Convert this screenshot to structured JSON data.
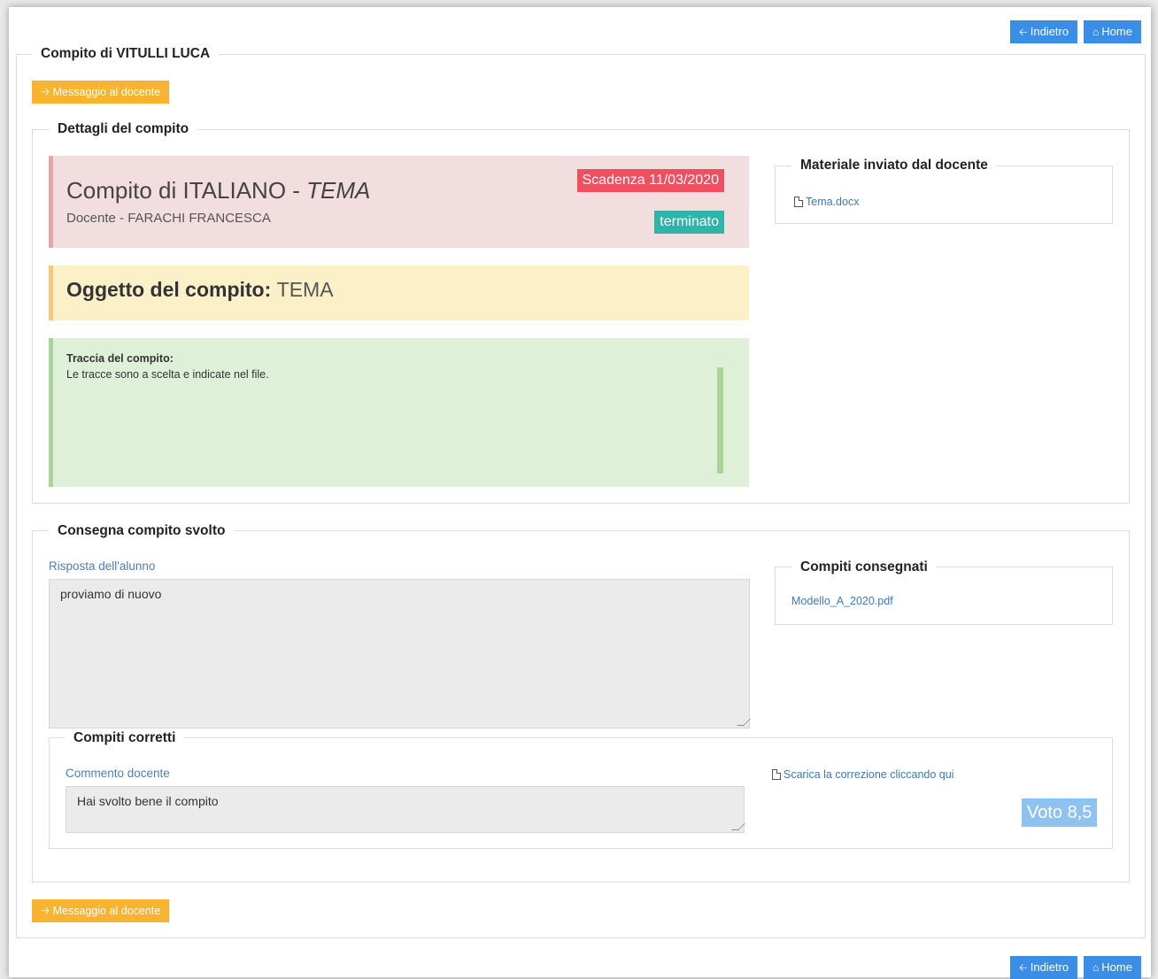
{
  "nav": {
    "back_label": "Indietro",
    "home_label": "Home"
  },
  "header": {
    "title": "Compito di VITULLI LUCA",
    "message_button": "Messaggio al docente"
  },
  "details": {
    "legend": "Dettagli del compito",
    "assignment_title": "Compito di ITALIANO - ",
    "assignment_type": "TEMA",
    "teacher": "Docente - FARACHI FRANCESCA",
    "deadline_badge": "Scadenza 11/03/2020",
    "status_badge": "terminato",
    "subject_label": "Oggetto del compito:",
    "subject_value": "TEMA",
    "trace_label": "Traccia del compito:",
    "trace_text": "Le tracce sono a scelta e indicate nel file."
  },
  "material": {
    "legend": "Materiale inviato dal docente",
    "file": "Tema.docx"
  },
  "submission": {
    "legend": "Consegna compito svolto",
    "answer_label": "Risposta dell'alunno",
    "answer_value": "proviamo di nuovo",
    "delivered_legend": "Compiti consegnati",
    "delivered_file": "Modello_A_2020.pdf"
  },
  "corrected": {
    "legend": "Compiti corretti",
    "comment_label": "Commento docente",
    "comment_value": "Hai svolto bene il compito",
    "download_link": "Scarica la correzione cliccando qui",
    "grade": "Voto 8,5"
  },
  "colors": {
    "primary": "#3a8ee6",
    "warning": "#f8b431",
    "danger": "#ef4f5f",
    "teal": "#2fb4aa",
    "grade": "#8fc3ef"
  },
  "icons": {
    "back": "arrow-left-icon",
    "home": "home-icon",
    "message": "arrow-right-icon",
    "file": "file-icon"
  }
}
